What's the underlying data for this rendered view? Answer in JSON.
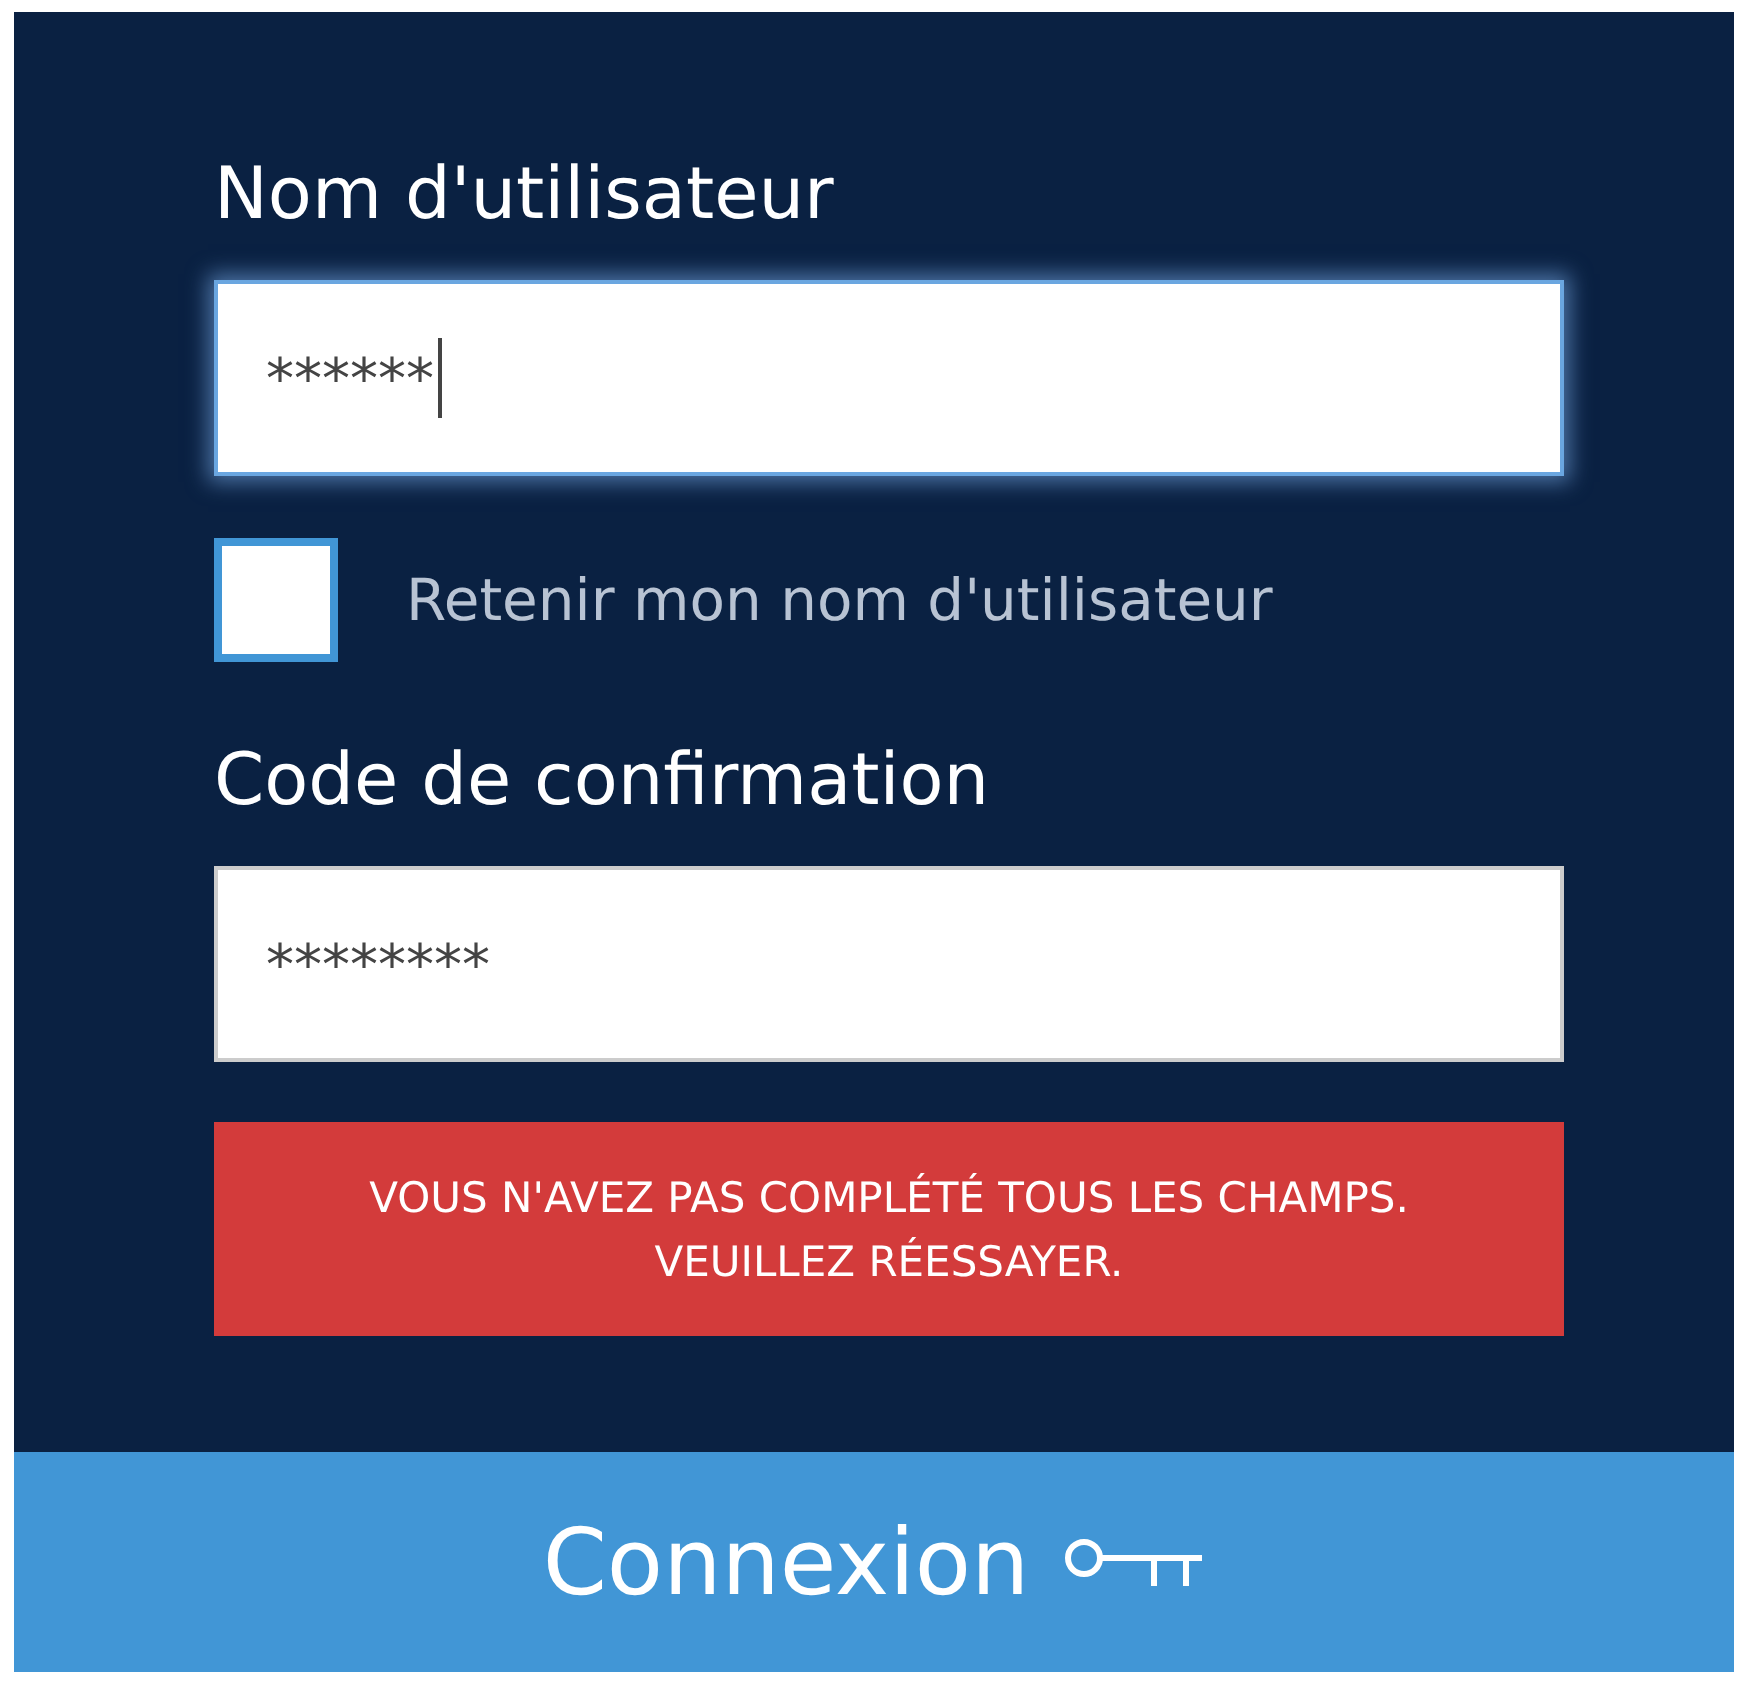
{
  "fields": [
    {
      "label": "Nom d'utilisateur",
      "value": "******",
      "focused": true
    },
    {
      "kind": "checkbox",
      "label": "Retenir mon nom d'utilisateur",
      "checked": false
    },
    {
      "label": "Code de confirmation",
      "value": "********",
      "focused": false
    }
  ],
  "error": {
    "lines": [
      "VOUS N'AVEZ PAS COMPLÉTÉ TOUS LES CHAMPS.",
      "VEUILLEZ RÉESSAYER."
    ]
  },
  "submit": {
    "label": "Connexion"
  }
}
